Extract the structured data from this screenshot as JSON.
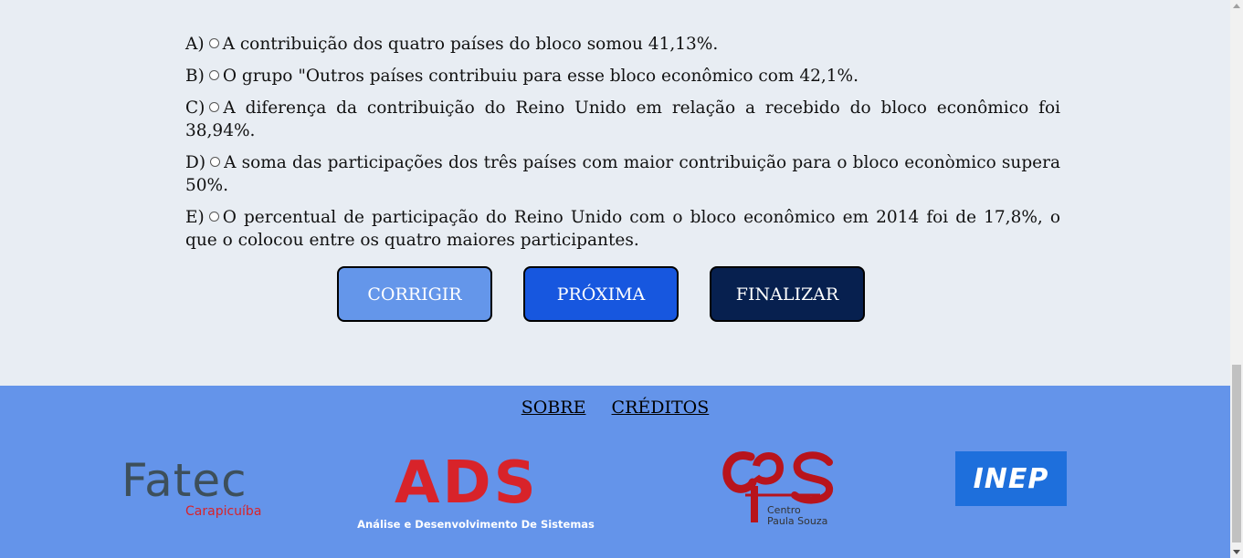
{
  "options": [
    {
      "letter": "A)",
      "text": "A contribuição dos quatro países do bloco somou 41,13%."
    },
    {
      "letter": "B)",
      "text": "O grupo \"Outros países contribuiu para esse bloco econômico com 42,1%."
    },
    {
      "letter": "C)",
      "text": "A diferença da contribuição do Reino Unido em relação a recebido do bloco econômico foi 38,94%."
    },
    {
      "letter": "D)",
      "text": "A soma das participações dos três países com maior contribuição para o bloco econòmico supera 50%."
    },
    {
      "letter": "E)",
      "text": "O percentual de participação do Reino Unido com o bloco econômico em 2014 foi de 17,8%, o que o colocou entre os quatro maiores participantes."
    }
  ],
  "buttons": {
    "corrigir": "CORRIGIR",
    "proxima": "PRÓXIMA",
    "finalizar": "FINALIZAR"
  },
  "footer": {
    "links": {
      "sobre": "SOBRE",
      "creditos": "CRÉDITOS"
    },
    "logos": {
      "fatec_name": "Fatec",
      "fatec_city": "Carapicuíba",
      "ads_name": "ADS",
      "ads_sub": "Análise e Desenvolvimento De Sistemas",
      "cps_line1": "Centro",
      "cps_line2": "Paula Souza",
      "inep_name": "INEP"
    }
  },
  "colors": {
    "page_bg": "#e8edf3",
    "footer_bg": "#6494ea",
    "btn_corrigir": "#6496ea",
    "btn_proxima": "#1757df",
    "btn_finalizar": "#07204f",
    "logo_red": "#d8232a",
    "inep_blue": "#1e6fdc"
  }
}
